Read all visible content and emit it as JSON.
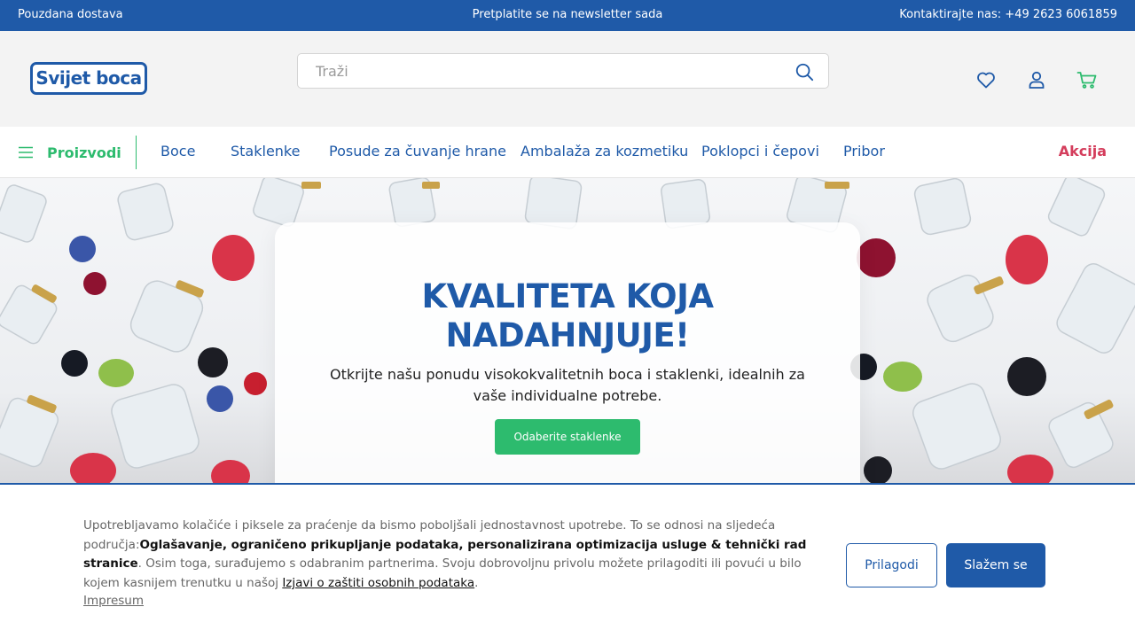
{
  "topbar": {
    "left_text": "Pouzdana dostava",
    "center_text": "Pretplatite se na newsletter sada",
    "contact_text": "Kontaktirajte nas: +49 2623 6061859"
  },
  "header": {
    "logo_text": "Svijet boca",
    "search_placeholder": "Traži",
    "icons": [
      "heart-icon",
      "user-icon",
      "cart-icon"
    ]
  },
  "nav": {
    "products_label": "Proizvodi",
    "items": [
      "Boce",
      "Staklenke",
      "Posude za čuvanje hrane",
      "Ambalaža za kozmetiku",
      "Poklopci i čepovi",
      "Pribor"
    ],
    "sale_label": "Akcija"
  },
  "hero": {
    "title_line1": "KVALITETA KOJA",
    "title_line2": "NADAHNJUJE!",
    "subtitle": "Otkrijte našu ponudu visokokvalitetnih boca i staklenki, idealnih za vaše individualne potrebe.",
    "button_label": "Odaberite staklenke"
  },
  "cookie": {
    "text_intro": "Upotrebljavamo kolačiće i piksele za praćenje da bismo poboljšali jednostavnost upotrebe. To se odnosi na sljedeća područja:",
    "text_bold": "Oglašavanje, ograničeno prikupljanje podataka, personalizirana optimizacija usluge & tehnički rad stranice",
    "text_mid": ". Osim toga, surađujemo s odabranim partnerima. Svoju dobrovoljnu privolu možete prilagoditi ili povući u bilo kojem kasnijem trenutku u našoj",
    "privacy_link": "Izjavi o zaštiti osobnih podataka",
    "text_end": ".",
    "impresum_link": "Impresum",
    "customize_label": "Prilagodi",
    "accept_label": "Slažem se"
  },
  "colors": {
    "brand_blue": "#1f5aa8",
    "accent_green": "#2dbb6e",
    "sale_red": "#d43d5c"
  }
}
